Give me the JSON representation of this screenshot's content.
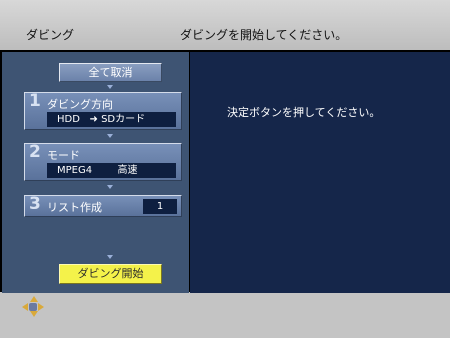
{
  "header": {
    "app_title": "ダビング",
    "instruction": "ダビングを開始してください。"
  },
  "left_panel": {
    "cancel_all_label": "全て取消",
    "steps": [
      {
        "number": "1",
        "label": "ダビング方向",
        "value_source": "HDD",
        "value_arrow": "➜",
        "value_dest": "SDカード"
      },
      {
        "number": "2",
        "label": "モード",
        "value_format": "MPEG4",
        "value_speed": "高速"
      },
      {
        "number": "3",
        "label": "リスト作成",
        "value": "1"
      }
    ],
    "start_dubbing_label": "ダビング開始"
  },
  "right_panel": {
    "message": "決定ボタンを押してください。"
  },
  "footer": {
    "nav_icon": "dpad-icon"
  },
  "colors": {
    "left_panel_bg": "#3e5473",
    "right_panel_bg": "#15264a",
    "start_button_bg": "#f4f24a",
    "title_bar_bg": "#c4c4c4"
  }
}
